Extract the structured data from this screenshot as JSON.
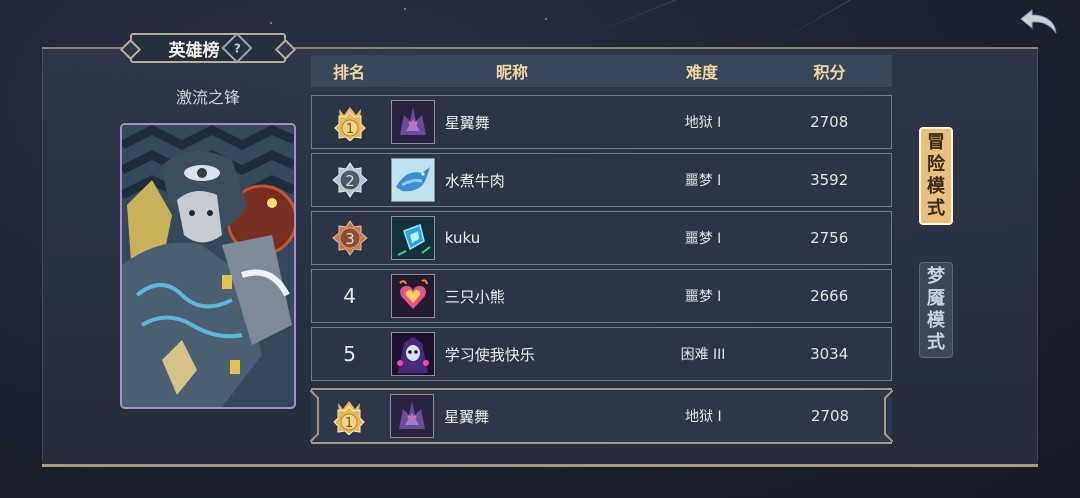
{
  "header": {
    "title": "英雄榜",
    "help_glyph": "?"
  },
  "hero": {
    "name": "激流之锋"
  },
  "table": {
    "columns": [
      "排名",
      "昵称",
      "难度",
      "积分"
    ],
    "rows": [
      {
        "rank": "1",
        "medal": "gold",
        "avatar": "dark-dragon-avatar",
        "nickname": "星翼舞",
        "difficulty": "地狱 I",
        "score": "2708"
      },
      {
        "rank": "2",
        "medal": "silver",
        "avatar": "blue-dragon-avatar",
        "nickname": "水煮牛肉",
        "difficulty": "噩梦 I",
        "score": "3592"
      },
      {
        "rank": "3",
        "medal": "bronze",
        "avatar": "blue-crystal-avatar",
        "nickname": "kuku",
        "difficulty": "噩梦 I",
        "score": "2756"
      },
      {
        "rank": "4",
        "medal": "",
        "avatar": "flame-heart-avatar",
        "nickname": "三只小熊",
        "difficulty": "噩梦 I",
        "score": "2666"
      },
      {
        "rank": "5",
        "medal": "",
        "avatar": "skull-mage-avatar",
        "nickname": "学习使我快乐",
        "difficulty": "困难 III",
        "score": "3034"
      }
    ],
    "self": {
      "rank": "1",
      "medal": "gold",
      "avatar": "dark-dragon-avatar",
      "nickname": "星翼舞",
      "difficulty": "地狱 I",
      "score": "2708"
    }
  },
  "modes": [
    {
      "label_lines": [
        "冒",
        "险",
        "模",
        "式"
      ],
      "active": true
    },
    {
      "label_lines": [
        "梦",
        "魇",
        "模",
        "式"
      ],
      "active": false
    }
  ],
  "colors": {
    "gold": "#e6b85a",
    "silver": "#b8c2cc",
    "bronze": "#c07a52",
    "header_text": "#f0d8a2",
    "active_tab": "#e8c17f"
  },
  "icons": {
    "back": "back-arrow-icon",
    "help": "help-icon"
  }
}
